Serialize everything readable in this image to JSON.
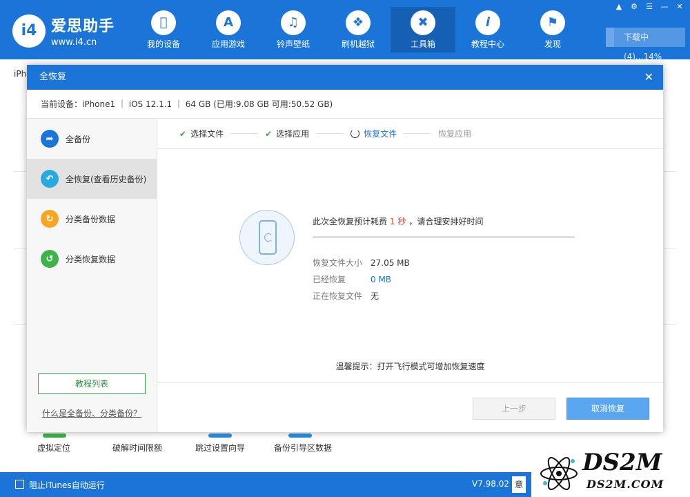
{
  "app": {
    "logo_mark": "i4",
    "logo_title": "爱思助手",
    "logo_url": "www.i4.cn",
    "download_status": "下载中(4)...14%"
  },
  "nav": [
    {
      "label": "我的设备",
      "icon": "apple-icon"
    },
    {
      "label": "应用游戏",
      "icon": "app-store-icon"
    },
    {
      "label": "铃声壁纸",
      "icon": "music-icon"
    },
    {
      "label": "刷机越狱",
      "icon": "dropbox-icon"
    },
    {
      "label": "工具箱",
      "icon": "tools-icon",
      "active": true
    },
    {
      "label": "教程中心",
      "icon": "info-icon"
    },
    {
      "label": "发现",
      "icon": "flag-icon"
    }
  ],
  "background": {
    "tab": "iPh",
    "tools": [
      "虚拟定位",
      "破解时间限额",
      "跳过设置向导",
      "备份引导区数据"
    ]
  },
  "statusbar": {
    "itunes_label": "阻止iTunes自动运行",
    "version": "V7.98.02",
    "btn_partial": "意"
  },
  "dialog": {
    "title": "全恢复",
    "device_info": "当前设备：iPhone1  ｜ iOS 12.1.1  ｜ 64 GB (已用:9.08 GB 可用:50.52 GB)",
    "sidebar": [
      {
        "label": "全备份",
        "color": "#1b74d8",
        "icon": "backup-icon"
      },
      {
        "label": "全恢复(查看历史备份)",
        "color": "#2aa8e0",
        "icon": "restore-icon",
        "active": true
      },
      {
        "label": "分类备份数据",
        "color": "#f5a623",
        "icon": "category-backup-icon"
      },
      {
        "label": "分类恢复数据",
        "color": "#3cb44a",
        "icon": "category-restore-icon"
      }
    ],
    "tutorial_button": "教程列表",
    "faq_link": "什么是全备份、分类备份？",
    "steps": [
      {
        "label": "选择文件",
        "state": "done"
      },
      {
        "label": "选择应用",
        "state": "done"
      },
      {
        "label": "恢复文件",
        "state": "current"
      },
      {
        "label": "恢复应用",
        "state": "pending"
      }
    ],
    "estimate_prefix": "此次全恢复预计耗费",
    "estimate_value": "1 秒",
    "estimate_suffix": "，请合理安排好时间",
    "progress_fraction": 0,
    "rows": [
      {
        "key": "恢复文件大小",
        "value": "27.05 MB"
      },
      {
        "key": "已经恢复",
        "value": "0 MB"
      },
      {
        "key": "正在恢复文件",
        "value": "无"
      }
    ],
    "tip": "温馨提示：打开飞行模式可增加恢复速度",
    "prev_button": "上一步",
    "cancel_button": "取消恢复"
  },
  "watermark": {
    "big": "DS2M",
    "small": "DS2M.COM"
  }
}
